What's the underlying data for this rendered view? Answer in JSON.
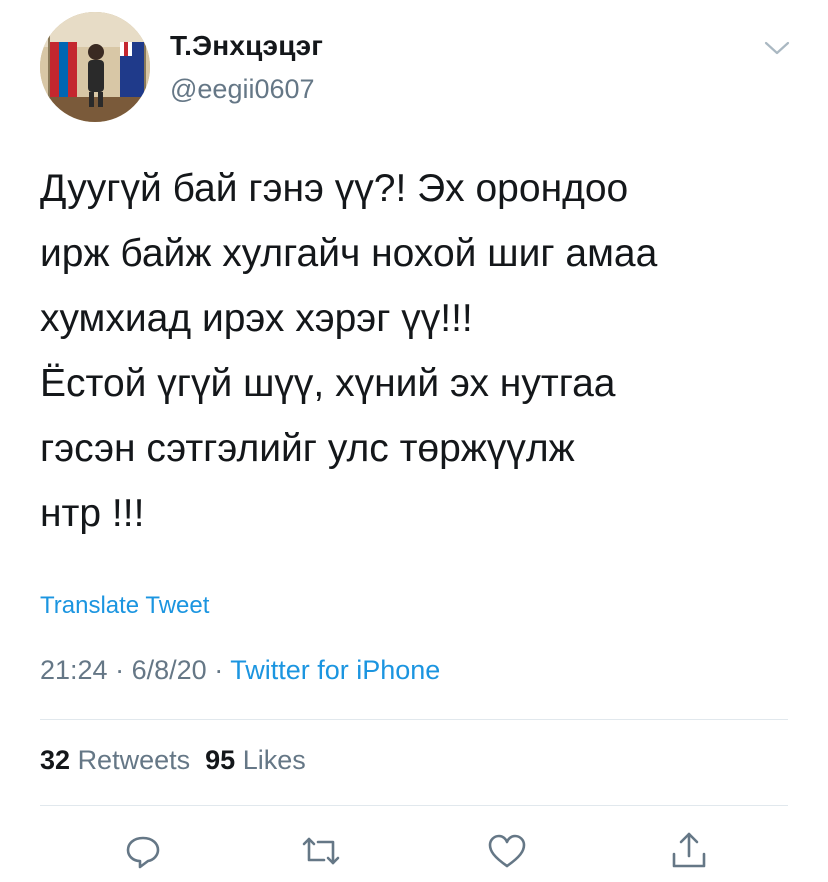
{
  "user": {
    "display_name": "Т.Энхцэцэг",
    "handle": "@eegii0607"
  },
  "tweet": {
    "text": "Дуугүй бай гэнэ үү?! Эх орондоо\nирж байж хулгайч нохой шиг амаа\nхумхиад ирэх хэрэг үү!!!\nЁстой үгүй шүү, хүний эх нутгаа\nгэсэн сэтгэлийг улс төржүүлж\nнтр !!!",
    "translate_label": "Translate Tweet",
    "time": "21:24",
    "date": "6/8/20",
    "source": "Twitter for iPhone",
    "separator": "·"
  },
  "stats": {
    "retweets_count": "32",
    "retweets_label": "Retweets",
    "likes_count": "95",
    "likes_label": "Likes"
  },
  "icons": {
    "more": "chevron-down-icon",
    "reply": "reply-icon",
    "retweet": "retweet-icon",
    "like": "heart-icon",
    "share": "share-icon"
  },
  "colors": {
    "link": "#1b95e0",
    "secondary_text": "#657786",
    "primary_text": "#14171a",
    "divider": "#e1e8ed"
  }
}
